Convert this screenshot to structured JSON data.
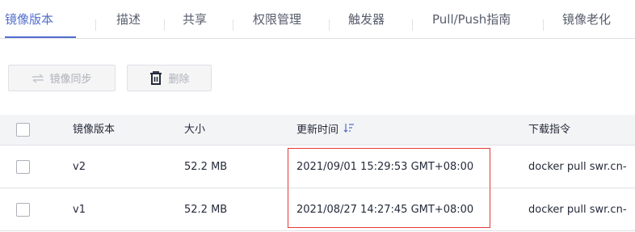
{
  "tabs": [
    {
      "label": "镜像版本",
      "active": true
    },
    {
      "label": "描述",
      "active": false
    },
    {
      "label": "共享",
      "active": false
    },
    {
      "label": "权限管理",
      "active": false
    },
    {
      "label": "触发器",
      "active": false
    },
    {
      "label": "Pull/Push指南",
      "active": false
    },
    {
      "label": "镜像老化",
      "active": false
    }
  ],
  "toolbar": {
    "sync_label": "镜像同步",
    "sync_icon": "sync-arrows-icon",
    "delete_label": "删除",
    "delete_icon": "trash-icon"
  },
  "table": {
    "columns": [
      "镜像版本",
      "大小",
      "更新时间",
      "下载指令"
    ],
    "sort_icon": "sort-descending-icon",
    "rows": [
      {
        "version": "v2",
        "size": "52.2 MB",
        "updated": "2021/09/01 15:29:53 GMT+08:00",
        "command": "docker pull swr.cn-"
      },
      {
        "version": "v1",
        "size": "52.2 MB",
        "updated": "2021/08/27 14:27:45 GMT+08:00",
        "command": "docker pull swr.cn-"
      }
    ]
  },
  "colors": {
    "accent": "#526ecc",
    "highlight_border": "#e53935",
    "header_bg": "#f3f4f6",
    "disabled_text": "#adb0b8"
  }
}
